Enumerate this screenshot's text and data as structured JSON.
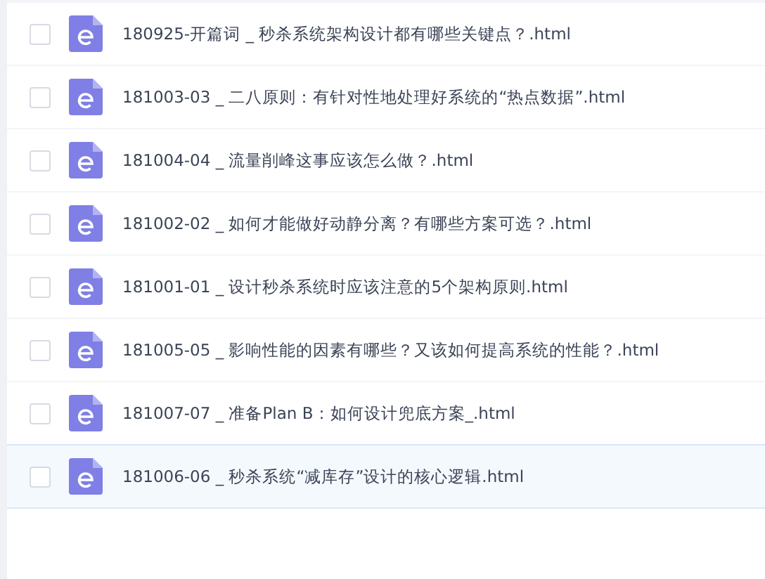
{
  "files": [
    {
      "name": "180925-开篇词 _ 秒杀系统架构设计都有哪些关键点？.html",
      "checked": false,
      "hovered": false
    },
    {
      "name": "181003-03 _ 二八原则：有针对性地处理好系统的“热点数据”.html",
      "checked": false,
      "hovered": false
    },
    {
      "name": "181004-04 _ 流量削峰这事应该怎么做？.html",
      "checked": false,
      "hovered": false
    },
    {
      "name": "181002-02 _ 如何才能做好动静分离？有哪些方案可选？.html",
      "checked": false,
      "hovered": false
    },
    {
      "name": "181001-01 _ 设计秒杀系统时应该注意的5个架构原则.html",
      "checked": false,
      "hovered": false
    },
    {
      "name": "181005-05 _ 影响性能的因素有哪些？又该如何提高系统的性能？.html",
      "checked": false,
      "hovered": false
    },
    {
      "name": "181007-07 _ 准备Plan B：如何设计兜底方案_.html",
      "checked": false,
      "hovered": false
    },
    {
      "name": "181006-06 _ 秒杀系统“减库存”设计的核心逻辑.html",
      "checked": false,
      "hovered": true
    }
  ]
}
